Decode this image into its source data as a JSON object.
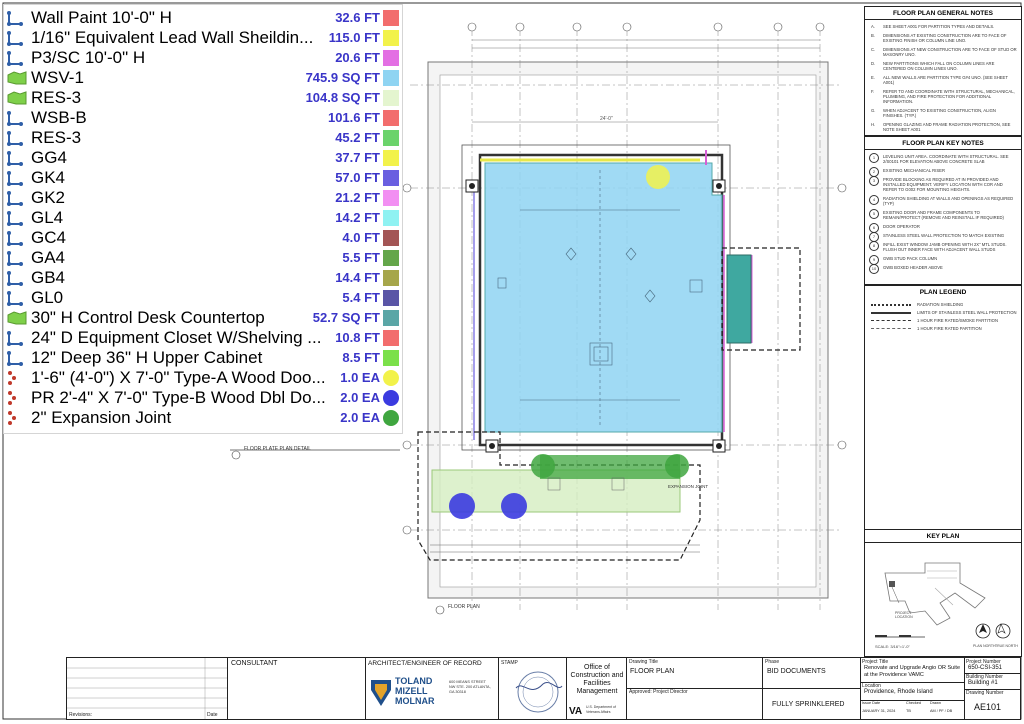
{
  "legend": {
    "items": [
      {
        "name": "Wall Paint 10'-0\" H",
        "qty": "32.6 FT",
        "color": "#f26d6d",
        "icon": "linear-measure-icon",
        "swatch": "square"
      },
      {
        "name": "1/16\" Equivalent Lead Wall Sheildin...",
        "qty": "115.0 FT",
        "color": "#f2f24a",
        "icon": "linear-measure-icon",
        "swatch": "square"
      },
      {
        "name": "P3/SC 10'-0\" H",
        "qty": "20.6 FT",
        "color": "#e36fe3",
        "icon": "linear-measure-icon",
        "swatch": "square"
      },
      {
        "name": "WSV-1",
        "qty": "745.9 SQ FT",
        "color": "#8fd4f2",
        "icon": "area-measure-icon",
        "swatch": "square"
      },
      {
        "name": "RES-3",
        "qty": "104.8 SQ FT",
        "color": "#e4f5cf",
        "icon": "area-measure-icon",
        "swatch": "square"
      },
      {
        "name": "WSB-B",
        "qty": "101.6 FT",
        "color": "#f26d6d",
        "icon": "linear-measure-icon",
        "swatch": "square"
      },
      {
        "name": "RES-3",
        "qty": "45.2 FT",
        "color": "#6bd36b",
        "icon": "linear-measure-icon",
        "swatch": "square"
      },
      {
        "name": "GG4",
        "qty": "37.7 FT",
        "color": "#f2f24a",
        "icon": "linear-measure-icon",
        "swatch": "square"
      },
      {
        "name": "GK4",
        "qty": "57.0 FT",
        "color": "#6a5fe0",
        "icon": "linear-measure-icon",
        "swatch": "square"
      },
      {
        "name": "GK2",
        "qty": "21.2 FT",
        "color": "#f28ff2",
        "icon": "linear-measure-icon",
        "swatch": "square"
      },
      {
        "name": "GL4",
        "qty": "14.2 FT",
        "color": "#8ff2f2",
        "icon": "linear-measure-icon",
        "swatch": "square"
      },
      {
        "name": "GC4",
        "qty": "4.0 FT",
        "color": "#a35555",
        "icon": "linear-measure-icon",
        "swatch": "square"
      },
      {
        "name": "GA4",
        "qty": "5.5 FT",
        "color": "#64a64a",
        "icon": "linear-measure-icon",
        "swatch": "square"
      },
      {
        "name": "GB4",
        "qty": "14.4 FT",
        "color": "#a6a64a",
        "icon": "linear-measure-icon",
        "swatch": "square"
      },
      {
        "name": "GL0",
        "qty": "5.4 FT",
        "color": "#5a55a6",
        "icon": "linear-measure-icon",
        "swatch": "square"
      },
      {
        "name": "30\" H Control Desk Countertop",
        "qty": "52.7 SQ FT",
        "color": "#5aa6a6",
        "icon": "area-measure-icon",
        "swatch": "square"
      },
      {
        "name": "24\" D Equipment Closet W/Shelving ...",
        "qty": "10.8 FT",
        "color": "#f26d6d",
        "icon": "linear-measure-icon",
        "swatch": "square"
      },
      {
        "name": "12\" Deep 36\" H Upper Cabinet",
        "qty": "8.5 FT",
        "color": "#7be04a",
        "icon": "linear-measure-icon",
        "swatch": "square"
      },
      {
        "name": "1'-6\" (4'-0\") X 7'-0\" Type-A Wood Doo...",
        "qty": "1.0 EA",
        "color": "#f2f24a",
        "icon": "count-icon",
        "swatch": "round"
      },
      {
        "name": "PR 2'-4\" X 7'-0\" Type-B Wood Dbl Do...",
        "qty": "2.0 EA",
        "color": "#3b3be0",
        "icon": "count-icon",
        "swatch": "round"
      },
      {
        "name": "2\" Expansion Joint",
        "qty": "2.0 EA",
        "color": "#3fa63f",
        "icon": "count-icon",
        "swatch": "round"
      }
    ]
  },
  "drawing": {
    "plan_title": "FLOOR PLAN",
    "detail_title": "FLOOR PLATE PLAN DETAIL",
    "expansion_label": "EXPANSION JOINT",
    "dim_top": "24'-0\""
  },
  "general_notes": {
    "title": "FLOOR PLAN GENERAL NOTES",
    "items": [
      {
        "k": "A.",
        "t": "SEE SHEET A001 FOR PARTITION TYPES AND DETAILS."
      },
      {
        "k": "B.",
        "t": "DIMENSIONS AT EXISTING CONSTRUCTION ARE TO FACE OF EXISTING FINISH OR COLUMN LINE UNO."
      },
      {
        "k": "C.",
        "t": "DIMENSIONS AT NEW CONSTRUCTION ARE TO FACE OF STUD OR MASONRY UNO."
      },
      {
        "k": "D.",
        "t": "NEW PARTITIONS WHICH FALL ON COLUMN LINES ARE CENTERED ON COLUMN LINES UNO."
      },
      {
        "k": "E.",
        "t": "ALL NEW WALLS ARE PARTITION TYPE G#4 UNO. (SEE SHEET A001)"
      },
      {
        "k": "F.",
        "t": "REFER TO AND COORDINATE WITH STRUCTURAL, MECHANICAL, PLUMBING, AND FIRE PROTECTION FOR ADDITIONAL INFORMATION."
      },
      {
        "k": "G.",
        "t": "WHEN ADJACENT TO EXISTING CONSTRUCTION, ALIGN FINISHES. (TYP.)"
      },
      {
        "k": "H.",
        "t": "OPENING GLAZING AND FRAME RADIATION PROTECTION, SEE NOTE SHEET A001"
      }
    ]
  },
  "key_notes": {
    "title": "FLOOR PLAN KEY NOTES",
    "items": [
      {
        "k": "1",
        "t": "LEVELING UNIT AREA. COORDINATE WITH STRUCTURAL. SEE 2/S0101 FOR ELEVATION ABOVE CONCRETE SLAB"
      },
      {
        "k": "2",
        "t": "EXISTING MECHANICAL RISER"
      },
      {
        "k": "3",
        "t": "PROVIDE BLOCKING AS REQUIRED AT IN PROVIDED AND INSTALLED EQUIPMENT. VERIFY LOCATION WITH COR AND REFER TO G002 FOR MOUNTING HEIGHTS."
      },
      {
        "k": "4",
        "t": "RADIATION SHIELDING AT WALLS AND OPENINGS AS REQUIRED (TYP)"
      },
      {
        "k": "5",
        "t": "EXISTING DOOR AND FRAME COMPONENTS TO REMAIN/PROTECT (REMOVE AND REINSTALL IF REQUIRED)"
      },
      {
        "k": "6",
        "t": "DOOR OPERATOR"
      },
      {
        "k": "7",
        "t": "STAINLESS STEEL WALL PROTECTION TO MATCH EXISTING"
      },
      {
        "k": "8",
        "t": "INFILL EXIST WINDOW JAMB OPENING WITH 2X\" MTL STUDS. FLUSH OUT INNER FACE WITH ADJACENT WALL STUDS"
      },
      {
        "k": "9",
        "t": "GWB STUD PACK COLUMN"
      },
      {
        "k": "10",
        "t": "GWB BOXED HEADER ABOVE"
      }
    ]
  },
  "plan_legend": {
    "title": "PLAN LEGEND",
    "items": [
      "RADIATION SHIELDING",
      "LIMITS OF STAINLESS STEEL WALL PROTECTION",
      "1 HOUR FIRE RATED/SMOKE PARTITION",
      "1 HOUR FIRE RATED PARTITION"
    ]
  },
  "key_plan": {
    "title": "KEY PLAN",
    "project_location": "PROJECT LOCATION",
    "scale": "SCALE: 3/16\"=1'-0\"",
    "plan_north": "PLAN NORTH",
    "true_north": "TRUE NORTH"
  },
  "title_block": {
    "revisions": "Revisions:",
    "date_label": "Date",
    "consultant": "CONSULTANT",
    "architect_label": "ARCHITECT/ENGINEER OF RECORD",
    "firm_line1": "TOLAND",
    "firm_line2": "MIZELL",
    "firm_line3": "MOLNAR",
    "firm_address": "600 MEANS STREET NW STE. 200 ATLANTA, GA 30318",
    "stamp": "STAMP",
    "office": "Office of Construction and Facilities Management",
    "va_mark": "VA",
    "va_dept": "U.S. Department of Veterans Affairs",
    "drawing_title_label": "Drawing Title",
    "drawing_title": "FLOOR PLAN",
    "approved_label": "Approved: Project Director",
    "phase_label": "Phase",
    "phase": "BID DOCUMENTS",
    "sprinkler": "FULLY SPRINKLERED",
    "project_title_label": "Project Title",
    "project_title": "Renovate and Upgrade Angio OR Suite at the Providence VAMC",
    "location_label": "Location",
    "location": "Providence, Rhode Island",
    "issue_date_label": "Issue Date",
    "issue_date": "JANUARY 31, 2024",
    "checked_label": "Checked",
    "checked": "TB",
    "drawn_label": "Drawn",
    "drawn": "AM / PF / DB",
    "project_number_label": "Project Number",
    "project_number": "650-CSI-351",
    "building_number_label": "Building Number",
    "building_number": "Building #1",
    "drawing_number_label": "Drawing Number",
    "drawing_number": "AE101"
  }
}
